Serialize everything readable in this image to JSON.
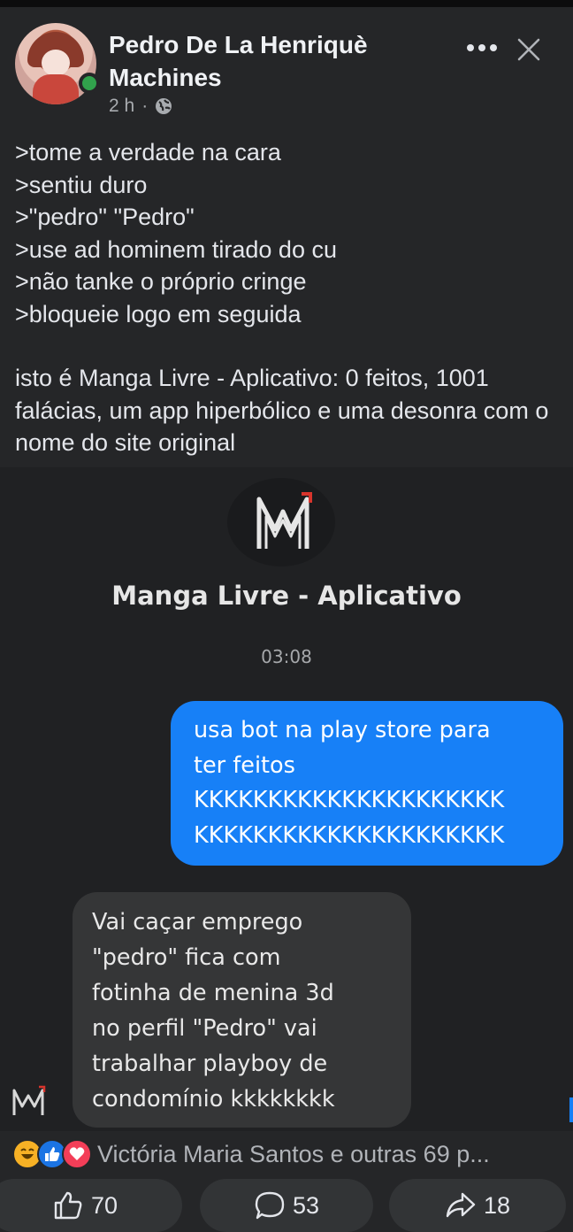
{
  "post": {
    "author": "Pedro De La Henriquè Machines",
    "time": "2 h",
    "separator": "·",
    "lines": [
      ">tome a verdade na cara",
      ">sentiu duro",
      ">\"pedro\" \"Pedro\"",
      ">use ad hominem tirado do cu",
      ">não tanke o próprio cringe",
      ">bloqueie logo em seguida"
    ],
    "paragraph": "isto é Manga Livre - Aplicativo: 0 feitos, 1001 falácias, um app hiperbólico e uma desonra com o nome do site original"
  },
  "screenshot": {
    "chat_title": "Manga Livre - Aplicativo",
    "timestamp": "03:08",
    "sent_message": [
      "usa bot na play store para",
      "ter feitos",
      "KKKKKKKKKKKKKKKKKKKKK",
      "KKKKKKKKKKKKKKKKKKKKK"
    ],
    "received_message": [
      "Vai caçar emprego",
      "\"pedro\" fica com",
      "fotinha de menina 3d",
      "no perfil \"Pedro\" vai",
      "trabalhar playboy de",
      "condomínio kkkkkkkk"
    ]
  },
  "reactions": {
    "icons": [
      "haha-icon",
      "like-icon",
      "love-icon"
    ],
    "summary": "Victória Maria Santos e outras 69 p..."
  },
  "actions": {
    "like_count": "70",
    "comment_count": "53",
    "share_count": "18"
  },
  "colors": {
    "background": "#252628",
    "sent_bubble": "#1780f7",
    "received_bubble": "#353637",
    "online": "#31a24c",
    "like": "#1b74e4",
    "love": "#f33e58",
    "haha": "#f7b125"
  }
}
